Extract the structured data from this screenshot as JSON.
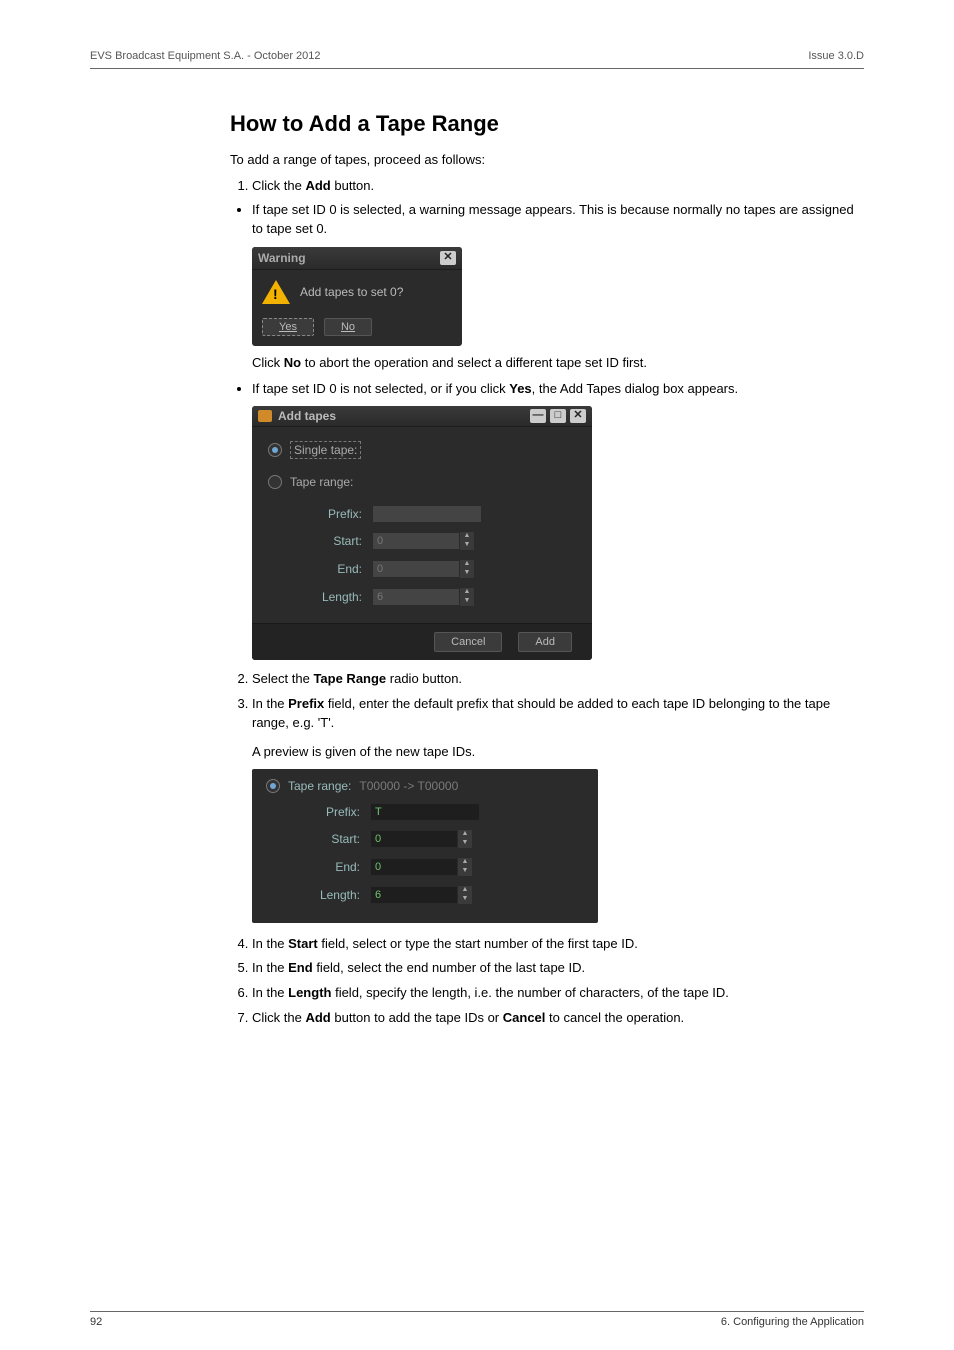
{
  "header": {
    "left": "EVS Broadcast Equipment S.A. - October 2012",
    "right": "Issue 3.0.D"
  },
  "h2": "How to Add a Tape Range",
  "intro": "To add a range of tapes, proceed as follows:",
  "step1_a": "Click the ",
  "step1_b": "Add",
  "step1_c": " button.",
  "bullet1": "If tape set ID 0 is selected, a warning message appears. This is because normally no tapes are assigned to tape set 0.",
  "warn": {
    "title": "Warning",
    "msg": "Add tapes to set 0?",
    "yes": "Yes",
    "no": "No",
    "close": "✕"
  },
  "after_warn_a": "Click ",
  "after_warn_b": "No",
  "after_warn_c": " to abort the operation and select a different tape set ID first.",
  "bullet2_a": "If tape set ID 0 is not selected, or if you click ",
  "bullet2_b": "Yes",
  "bullet2_c": ", the Add Tapes dialog box appears.",
  "addtapes": {
    "title": "Add tapes",
    "single": "Single tape:",
    "range": "Tape range:",
    "prefix": "Prefix:",
    "start": "Start:",
    "end": "End:",
    "length": "Length:",
    "start_v": "0",
    "end_v": "0",
    "length_v": "6",
    "cancel": "Cancel",
    "add": "Add",
    "min": "—",
    "max": "□",
    "close": "✕"
  },
  "step2_a": "Select the ",
  "step2_b": "Tape Range",
  "step2_c": " radio button.",
  "step3_a": "In the ",
  "step3_b": "Prefix",
  "step3_c": " field, enter the default prefix that should be added to each tape ID belonging to the tape range, e.g. 'T'.",
  "step3_note": "A preview is given of the new tape IDs.",
  "preview": {
    "label": "Tape range:",
    "val": "T00000 -> T00000",
    "prefix": "Prefix:",
    "prefix_v": "T",
    "start": "Start:",
    "start_v": "0",
    "end": "End:",
    "end_v": "0",
    "length": "Length:",
    "length_v": "6"
  },
  "step4_a": "In the ",
  "step4_b": "Start",
  "step4_c": " field, select or type the start number of the first tape ID.",
  "step5_a": "In the ",
  "step5_b": "End",
  "step5_c": " field, select the end number of the last tape ID.",
  "step6_a": "In the ",
  "step6_b": "Length",
  "step6_c": " field, specify the length, i.e. the number of characters, of the tape ID.",
  "step7_a": "Click the ",
  "step7_b": "Add",
  "step7_c": " button to add the tape IDs or ",
  "step7_d": "Cancel",
  "step7_e": " to cancel the operation.",
  "footer": {
    "left": "92",
    "right": "6. Configuring the Application"
  }
}
